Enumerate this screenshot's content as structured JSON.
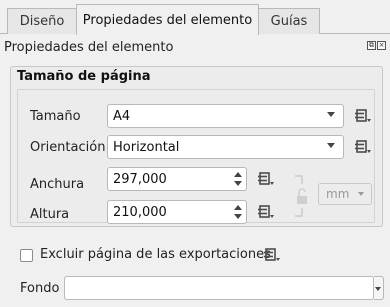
{
  "tabs": [
    {
      "label": "Diseño",
      "active": false
    },
    {
      "label": "Propiedades del elemento",
      "active": true
    },
    {
      "label": "Guías",
      "active": false
    }
  ],
  "panel": {
    "title": "Propiedades del elemento"
  },
  "page_size": {
    "group_title": "Tamaño de página",
    "size_label": "Tamaño",
    "size_value": "A4",
    "orientation_label": "Orientación",
    "orientation_value": "Horizontal",
    "width_label": "Anchura",
    "width_value": "297,000",
    "height_label": "Altura",
    "height_value": "210,000",
    "unit_value": "mm"
  },
  "exclude": {
    "label": "Excluir página de las exportaciones",
    "checked": false
  },
  "background": {
    "label": "Fondo",
    "value": ""
  },
  "icons": {
    "data_defined": "data-defined-override-icon",
    "lock": "lock-icon"
  },
  "colors": {
    "panel_bg": "#f0f0f0",
    "icon": "#4d4d4d"
  }
}
